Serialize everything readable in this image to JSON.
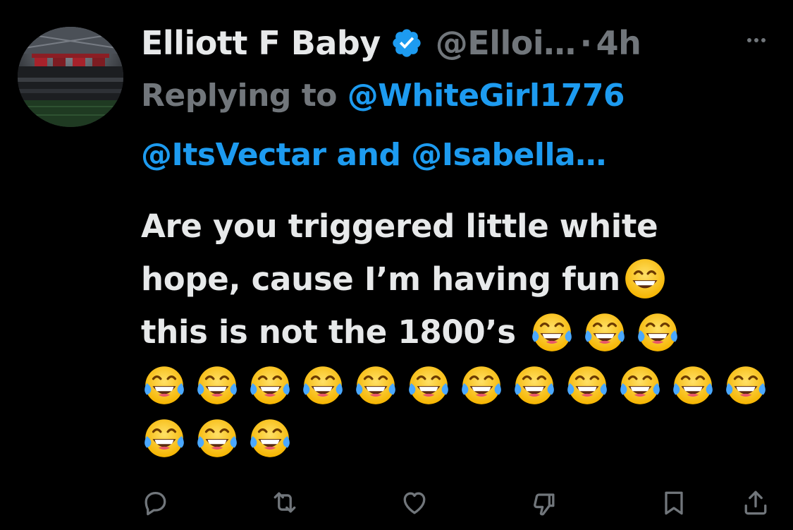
{
  "tweet": {
    "author": {
      "display_name": "Elliott F Baby",
      "handle": "@Elloi…",
      "verified": true
    },
    "separator": "·",
    "time": "4h",
    "replying": {
      "prefix": "Replying to",
      "user1": "@WhiteGirl1776",
      "user2": "@ItsVectar",
      "conjunction": "and",
      "user3": "@Isabella…"
    },
    "text": {
      "line1": "Are you triggered little white",
      "line2": "hope, cause I’m having fun",
      "line3": "this is not the 1800’s"
    },
    "emojis": {
      "grin": "smiling-face-with-open-mouth-emoji",
      "laugh": "face-with-tears-of-joy-emoji",
      "laugh_count": 18
    }
  },
  "actions": [
    "reply-icon",
    "retweet-icon",
    "like-icon",
    "downvote-icon",
    "bookmark-icon",
    "share-icon"
  ],
  "colors": {
    "background": "#000000",
    "text": "#e7e9ea",
    "muted": "#71767b",
    "link": "#1d9bf0",
    "verified": "#1d9bf0"
  }
}
